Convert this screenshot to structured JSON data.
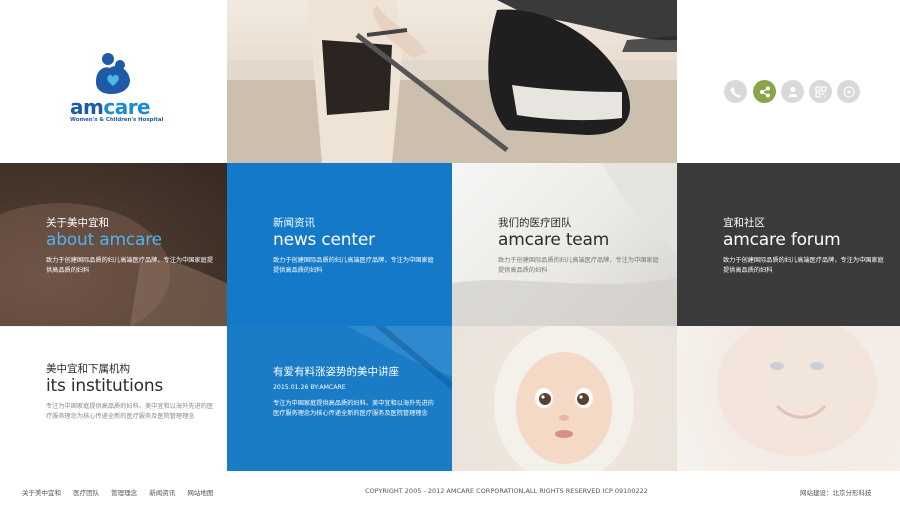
{
  "brand": {
    "name_part1": "am",
    "name_part2": "care",
    "subtitle": "Women's & Children's Hospital",
    "blue": "#1e5aa6",
    "light_blue": "#1b8bd6"
  },
  "social_icons": [
    {
      "name": "phone-icon",
      "active": false
    },
    {
      "name": "share-icon",
      "active": true
    },
    {
      "name": "user-icon",
      "active": false
    },
    {
      "name": "qrcode-icon",
      "active": false
    },
    {
      "name": "chevron-down-icon",
      "active": false
    }
  ],
  "tiles": {
    "about": {
      "cn": "关于美中宜和",
      "en": "about amcare",
      "desc": "致力于创建国际品质的妇儿高端医疗品牌，专注为中国家庭提供高品质的妇科"
    },
    "news": {
      "cn": "新闻资讯",
      "en": "news center",
      "desc": "致力于创建国际品质的妇儿高端医疗品牌，专注为中国家庭提供高品质的妇科"
    },
    "team": {
      "cn": "我们的医疗团队",
      "en": "amcare team",
      "desc": "致力于创建国际品质的妇儿高端医疗品牌，专注为中国家庭提供高品质的妇科"
    },
    "forum": {
      "cn": "宜和社区",
      "en": "amcare forum",
      "desc": "致力于创建国际品质的妇儿高端医疗品牌，专注为中国家庭提供高品质的妇科"
    },
    "institutions": {
      "cn": "美中宜和下属机构",
      "en": "its institutions",
      "desc": "专注为中国家庭提供高品质的妇科、美中宜和以海外先进的医疗服务理念为核心传递全新的医疗服务及医院管理理念"
    },
    "lecture": {
      "title": "有爱有料涨姿势的美中讲座",
      "meta": "2015.01.26 BY:AMCARE",
      "desc": "专注为中国家庭提供高品质的妇科、美中宜和以海外先进的医疗服务理念为核心传递全新的医疗服务及医院管理理念"
    }
  },
  "footer": {
    "links": [
      "关于美中宜和",
      "医疗团队",
      "管理理念",
      "新闻资讯",
      "网站地图"
    ],
    "copyright": "COPYRIGHT 2005 - 2012 AMCARE CORPORATION,ALL RIGHTS RESERVED   ICP 09100222",
    "credit": "网站建设：北京分形科技"
  },
  "colors": {
    "news_blue": "#1479c9",
    "forum_dark": "#3b3b3b",
    "share_green": "#8aa44a"
  }
}
